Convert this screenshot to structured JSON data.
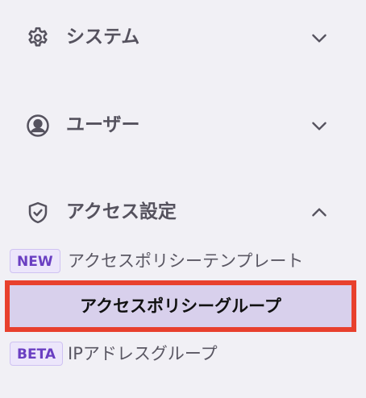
{
  "sidebar": {
    "sections": [
      {
        "label": "システム",
        "icon": "gear-icon",
        "expanded": false
      },
      {
        "label": "ユーザー",
        "icon": "user-circle-icon",
        "expanded": false
      },
      {
        "label": "アクセス設定",
        "icon": "shield-check-icon",
        "expanded": true
      }
    ],
    "access_items": [
      {
        "badge": "NEW",
        "label": "アクセスポリシーテンプレート"
      },
      {
        "label": "アクセスポリシーグループ",
        "selected": true
      },
      {
        "badge": "BETA",
        "label": "IPアドレスグループ"
      }
    ]
  },
  "colors": {
    "background": "#f1f0f5",
    "text": "#55525e",
    "selected_bg": "#d8d0ec",
    "highlight_border": "#e8402d",
    "badge_text": "#6a3fc2",
    "badge_bg": "#ece6fb"
  }
}
